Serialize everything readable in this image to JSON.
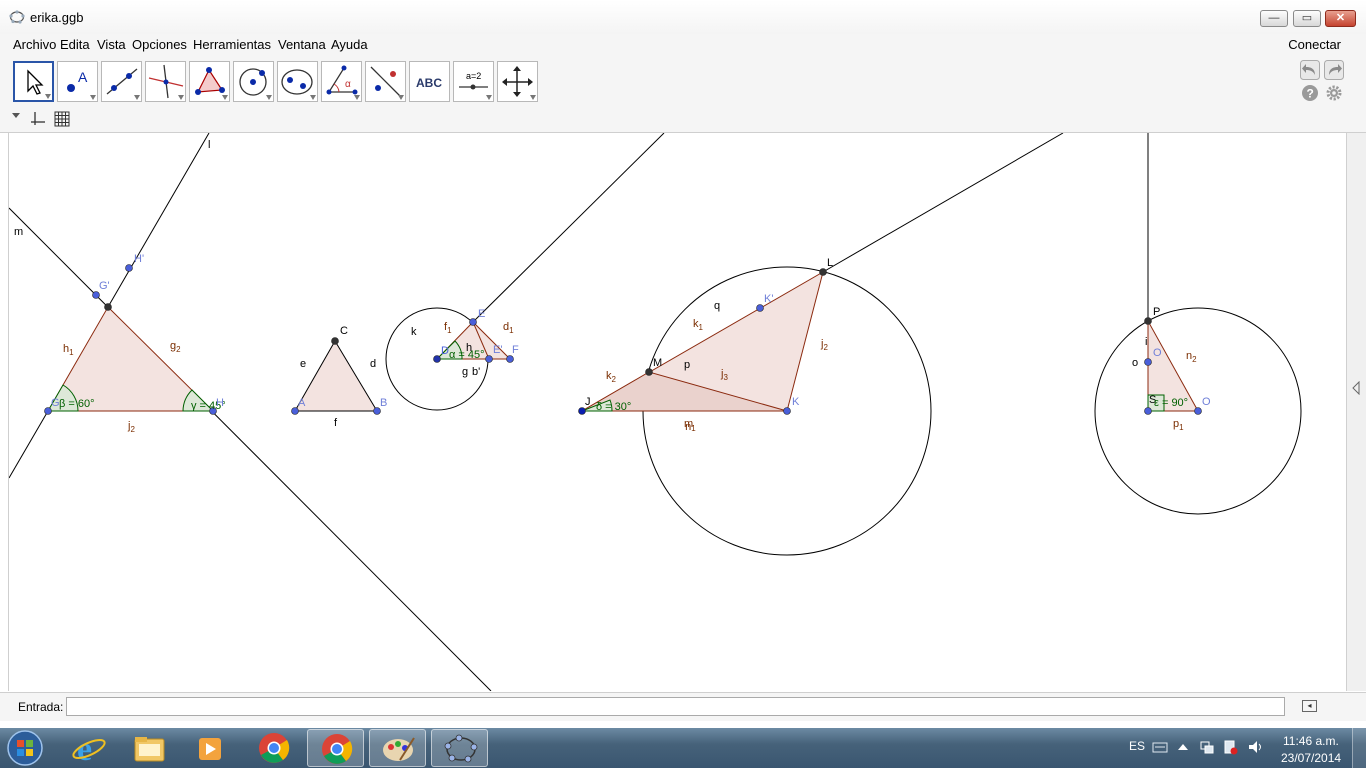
{
  "window": {
    "title": "erika.ggb",
    "min_symbol": "—",
    "max_symbol": "▭",
    "close_symbol": "✕"
  },
  "menu": {
    "items": [
      "Archivo",
      "Edita",
      "Vista",
      "Opciones",
      "Herramientas",
      "Ventana",
      "Ayuda"
    ],
    "connect": "Conectar"
  },
  "toolbar": {
    "tools": [
      {
        "name": "move-tool",
        "selected": true
      },
      {
        "name": "point-tool",
        "text": "A"
      },
      {
        "name": "line-tool"
      },
      {
        "name": "perpendicular-line-tool"
      },
      {
        "name": "polygon-tool"
      },
      {
        "name": "circle-center-point-tool"
      },
      {
        "name": "conic-through-points-tool"
      },
      {
        "name": "angle-tool",
        "text": "α"
      },
      {
        "name": "reflect-tool"
      },
      {
        "name": "text-tool",
        "text": "ABC"
      },
      {
        "name": "slider-tool",
        "text": "a=2"
      },
      {
        "name": "move-graphics-view-tool"
      }
    ],
    "right_icons": [
      "undo-icon",
      "redo-icon",
      "help-icon",
      "settings-icon"
    ]
  },
  "graphics": {
    "labels": {
      "l": "l",
      "m": "m",
      "G1": "G'",
      "H1": "H'",
      "h1": "h",
      "h1s": "1",
      "g2": "g",
      "g2s": "2",
      "beta": "β = 60°",
      "gamma": "γ = 45°",
      "G": "G",
      "H": "H",
      "j2": "j",
      "j2s": "2",
      "C": "C",
      "e": "e",
      "d": "d",
      "A": "A",
      "B": "B",
      "f": "f",
      "k": "k",
      "E": "E",
      "f1": "f",
      "f1s": "1",
      "d1": "d",
      "d1s": "1",
      "D": "D",
      "alpha": "α = 45°",
      "h": "h",
      "E2": "E'",
      "F": "F",
      "g": "g",
      "b1": "b'",
      "L": "L",
      "q": "q",
      "K1": "K'",
      "k1": "k",
      "k1s": "1",
      "j2b": "j",
      "j2bs": "2",
      "M": "M",
      "p": "p",
      "j3": "j",
      "j3s": "3",
      "k2": "k",
      "k2s": "2",
      "J": "J",
      "delta": "δ = 30°",
      "K": "K",
      "m1": "m",
      "m1b": "n",
      "m1s": "1",
      "P": "P",
      "i": "i",
      "O1": "O",
      "o": "o",
      "n2": "n",
      "n2s": "2",
      "S": "S",
      "eps": "ε = 90°",
      "O": "O",
      "p1": "p",
      "p1s": "1"
    }
  },
  "input": {
    "label": "Entrada:",
    "value": "",
    "help": "◂"
  },
  "taskbar": {
    "items": [
      {
        "name": "start-button"
      },
      {
        "name": "internet-explorer-icon"
      },
      {
        "name": "file-explorer-icon"
      },
      {
        "name": "media-player-icon"
      },
      {
        "name": "chrome-icon"
      },
      {
        "name": "chrome-icon-2"
      },
      {
        "name": "paint-icon"
      },
      {
        "name": "geogebra-icon",
        "active": true
      }
    ],
    "lang": "ES",
    "time": "11:46 a.m.",
    "date": "23/07/2014"
  },
  "colors": {
    "point_blue": "#4a5fd9",
    "point_dark": "#333333",
    "fill": "#f3e3e0",
    "edge": "#8b2a0f",
    "angle_green": "#006000",
    "label_brown": "#7a2d00"
  }
}
